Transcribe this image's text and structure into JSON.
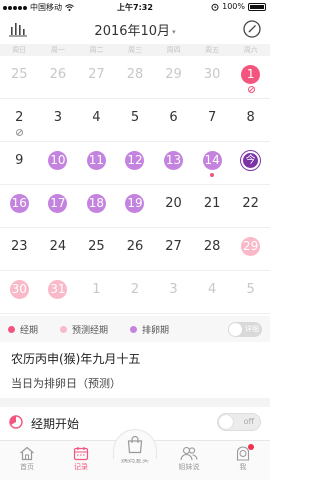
{
  "status_bar": {
    "carrier": "中国移动",
    "time": "上午7:32",
    "battery": "100%"
  },
  "header": {
    "title": "2016年10月"
  },
  "weekdays": [
    "周日",
    "周一",
    "周二",
    "周三",
    "周四",
    "周五",
    "周六"
  ],
  "calendar": {
    "weeks": [
      [
        {
          "d": "25",
          "s": "muted"
        },
        {
          "d": "26",
          "s": "muted"
        },
        {
          "d": "27",
          "s": "muted"
        },
        {
          "d": "28",
          "s": "muted"
        },
        {
          "d": "29",
          "s": "muted"
        },
        {
          "d": "30",
          "s": "muted"
        },
        {
          "d": "1",
          "s": "period",
          "m": "slash"
        }
      ],
      [
        {
          "d": "2",
          "s": "normal",
          "m": "slash-grey"
        },
        {
          "d": "3",
          "s": "normal"
        },
        {
          "d": "4",
          "s": "normal"
        },
        {
          "d": "5",
          "s": "normal"
        },
        {
          "d": "6",
          "s": "normal"
        },
        {
          "d": "7",
          "s": "normal"
        },
        {
          "d": "8",
          "s": "normal"
        }
      ],
      [
        {
          "d": "9",
          "s": "normal"
        },
        {
          "d": "10",
          "s": "ovu"
        },
        {
          "d": "11",
          "s": "ovu"
        },
        {
          "d": "12",
          "s": "ovu"
        },
        {
          "d": "13",
          "s": "ovu"
        },
        {
          "d": "14",
          "s": "ovu",
          "m": "dot"
        },
        {
          "d": "今",
          "s": "today"
        }
      ],
      [
        {
          "d": "16",
          "s": "ovu"
        },
        {
          "d": "17",
          "s": "ovu"
        },
        {
          "d": "18",
          "s": "ovu"
        },
        {
          "d": "19",
          "s": "ovu"
        },
        {
          "d": "20",
          "s": "normal"
        },
        {
          "d": "21",
          "s": "normal"
        },
        {
          "d": "22",
          "s": "normal"
        }
      ],
      [
        {
          "d": "23",
          "s": "normal"
        },
        {
          "d": "24",
          "s": "normal"
        },
        {
          "d": "25",
          "s": "normal"
        },
        {
          "d": "26",
          "s": "normal"
        },
        {
          "d": "27",
          "s": "normal"
        },
        {
          "d": "28",
          "s": "normal"
        },
        {
          "d": "29",
          "s": "pred"
        }
      ],
      [
        {
          "d": "30",
          "s": "pred"
        },
        {
          "d": "31",
          "s": "pred"
        },
        {
          "d": "1",
          "s": "muted"
        },
        {
          "d": "2",
          "s": "muted"
        },
        {
          "d": "3",
          "s": "muted"
        },
        {
          "d": "4",
          "s": "muted"
        },
        {
          "d": "5",
          "s": "muted"
        }
      ]
    ]
  },
  "legend": {
    "items": [
      {
        "label": "经期",
        "color": "#f4557e"
      },
      {
        "label": "预测经期",
        "color": "#f9b9c8"
      },
      {
        "label": "排卵期",
        "color": "#c483df"
      }
    ],
    "toggle_label": "详细"
  },
  "info": {
    "lunar_date": "农历丙申(猴)年九月十五",
    "status_text": "当日为排卵日（预测）"
  },
  "period_start": {
    "label": "经期开始",
    "toggle_label": "off"
  },
  "tabbar": {
    "tabs": [
      {
        "label": "首页",
        "icon": "home-icon"
      },
      {
        "label": "记录",
        "icon": "calendar-icon",
        "active": true
      },
      {
        "label": "姨妈爱买",
        "icon": "shopping-bag-icon"
      },
      {
        "label": "姐妹说",
        "icon": "people-icon"
      },
      {
        "label": "我",
        "icon": "profile-icon"
      }
    ]
  },
  "colors": {
    "period": "#f4557e",
    "predicted_period": "#f9b9c8",
    "ovulation": "#c483df",
    "today": "#7b33a6"
  }
}
